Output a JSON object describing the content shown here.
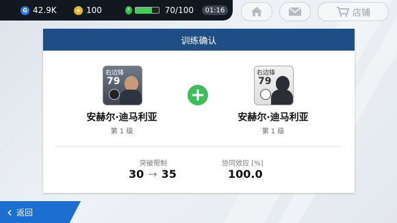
{
  "status_bar": {
    "gp": {
      "icon": "gp-coin-icon",
      "letter": "G",
      "value": "42.9K"
    },
    "coins": {
      "icon": "coin-icon",
      "value": "100"
    },
    "energy": {
      "icon": "energy-bolt-icon",
      "value": "70/100",
      "fill_fraction": 0.7
    },
    "timer": "01:16"
  },
  "top_buttons": [
    {
      "icon": "home-icon"
    },
    {
      "icon": "mail-icon"
    },
    {
      "icon": "cart-icon",
      "label": "店铺"
    }
  ],
  "dialog": {
    "title": "训练确认",
    "left_player": {
      "position": "右边锋",
      "rating": "79",
      "name": "安赫尔·迪马利亚",
      "level": "第 1 级"
    },
    "right_player": {
      "position": "右边锋",
      "rating": "79",
      "name": "安赫尔·迪马利亚",
      "level": "第 1 级"
    },
    "plus_symbol": "+",
    "breakthrough": {
      "label": "突破限制",
      "from": "30",
      "arrow": "→",
      "to": "35"
    },
    "synergy": {
      "label": "协同效应 [%]",
      "value": "100.0"
    }
  },
  "back_button": {
    "label": "返回"
  },
  "colors": {
    "header": "#1f4e86",
    "accent_green": "#3cbf5b",
    "back_blue": "#1c6fd0"
  }
}
